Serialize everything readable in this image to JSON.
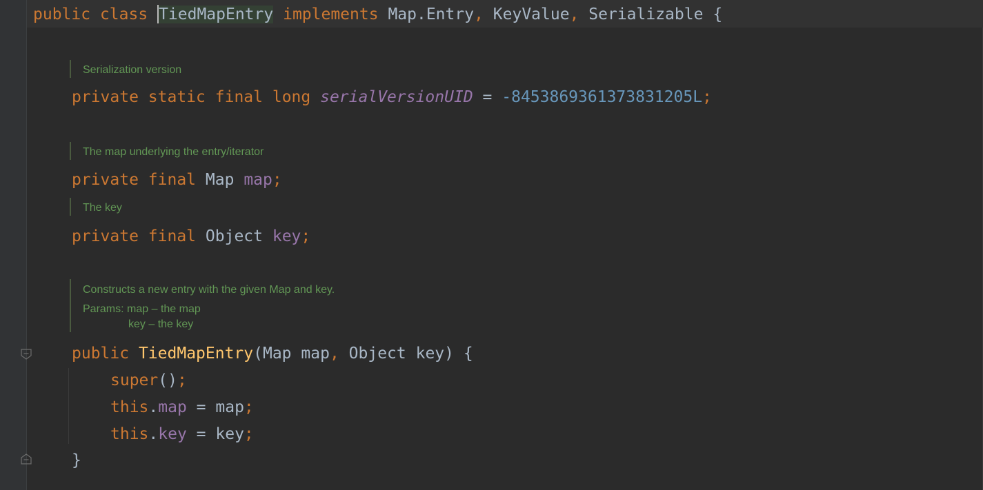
{
  "editor": {
    "line_class": {
      "t_public": "public",
      "t_class": "class",
      "t_classname": "TiedMapEntry",
      "t_implements": "implements",
      "t_mapentry": "Map.Entry",
      "t_comma1": ",",
      "t_keyvalue": "KeyValue",
      "t_comma2": ",",
      "t_serializable": "Serializable",
      "t_brace": "{"
    },
    "doc_serial": "Serialization version",
    "line_serial": {
      "t_private": "private",
      "t_static": "static",
      "t_final": "final",
      "t_long": "long",
      "t_name": "serialVersionUID",
      "t_eq": "=",
      "t_value": "-8453869361373831205L",
      "t_semi": ";"
    },
    "doc_map": "The map underlying the entry/iterator",
    "line_map": {
      "t_private": "private",
      "t_final": "final",
      "t_type": "Map",
      "t_name": "map",
      "t_semi": ";"
    },
    "doc_key": "The key",
    "line_key": {
      "t_private": "private",
      "t_final": "final",
      "t_type": "Object",
      "t_name": "key",
      "t_semi": ";"
    },
    "doc_ctor": {
      "summary": "Constructs a new entry with the given Map and key.",
      "params_label": "Params:",
      "param_map": "map – the map",
      "param_key": "key – the key"
    },
    "line_ctor": {
      "t_public": "public",
      "t_name": "TiedMapEntry",
      "t_open": "(",
      "t_type1": "Map",
      "t_arg1": "map",
      "t_comma": ",",
      "t_type2": "Object",
      "t_arg2": "key",
      "t_close": ")",
      "t_brace": "{"
    },
    "line_super": {
      "t_super": "super",
      "t_parens": "()",
      "t_semi": ";"
    },
    "line_thismap": {
      "t_this": "this",
      "t_dot": ".",
      "t_field": "map",
      "t_eq": "=",
      "t_value": "map",
      "t_semi": ";"
    },
    "line_thiskey": {
      "t_this": "this",
      "t_dot": ".",
      "t_field": "key",
      "t_eq": "=",
      "t_value": "key",
      "t_semi": ";"
    },
    "line_end": {
      "t_brace": "}"
    },
    "colors": {
      "background": "#2b2b2b",
      "keyword": "#cc7832",
      "identifier": "#a9b7c6",
      "field": "#9876aa",
      "number": "#6897bb",
      "method": "#ffc66d",
      "doc_comment": "#629755"
    }
  }
}
